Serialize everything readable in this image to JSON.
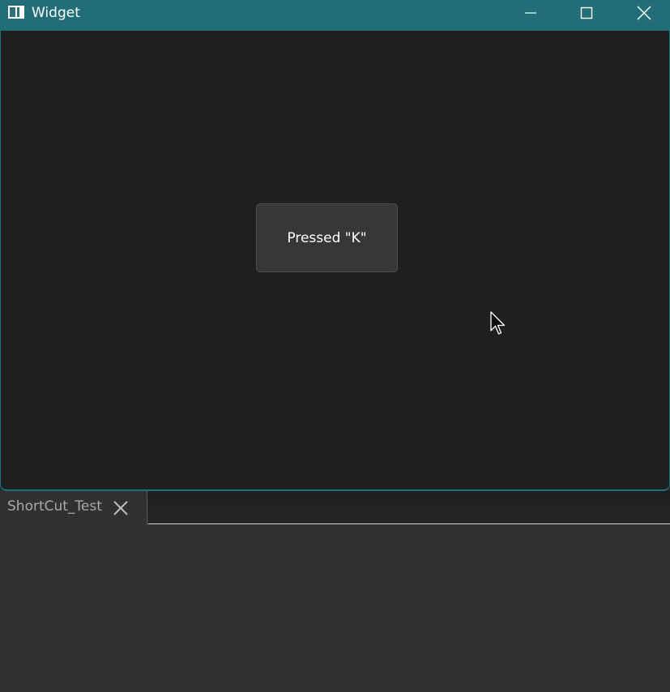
{
  "window": {
    "title": "Widget",
    "titlebar_color": "#226e78",
    "background_color": "#1f1f1f",
    "controls": {
      "minimize_icon": "minimize-icon",
      "maximize_icon": "maximize-icon",
      "close_icon": "close-icon"
    }
  },
  "content": {
    "button_label": "Pressed \"K\""
  },
  "tab": {
    "label": "ShortCut_Test",
    "close_icon": "close-icon"
  }
}
